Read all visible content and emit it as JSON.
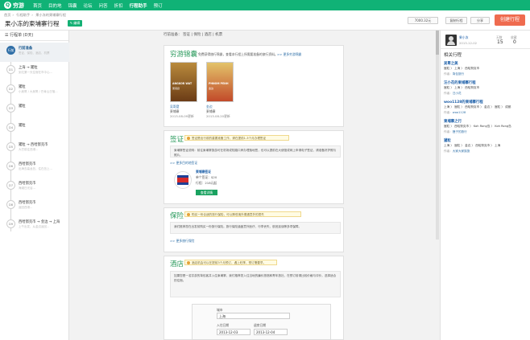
{
  "nav": {
    "logo": "穷游",
    "items": [
      "首页",
      "目的地",
      "锦囊",
      "论坛",
      "问答",
      "折扣",
      "行程助手",
      "预订"
    ],
    "active_index": 6
  },
  "breadcrumb": [
    "首页",
    "行程助手",
    "果小冻的柬埔寨行程"
  ],
  "page": {
    "title": "果小冻的柬埔寨行程",
    "badge": "✎ 编辑"
  },
  "header_buttons": {
    "cost": "7000.32元",
    "copy": "复制行程",
    "share": "分享",
    "create": "创建行程"
  },
  "left": {
    "header": "行程单 (D天)",
    "items": [
      {
        "circle": "行前",
        "title": "行前准备",
        "sub": "签证、保险、酒店、机票",
        "selected": true
      },
      {
        "circle": "D1",
        "title": "上海 → 暹粒",
        "sub": "到达第一天住宿在市中心..."
      },
      {
        "circle": "D2",
        "title": "暹粒",
        "sub": "小吴哥 / 大吴哥 / 巴肯山日落..."
      },
      {
        "circle": "D3",
        "title": "暹粒",
        "sub": ""
      },
      {
        "circle": "D4",
        "title": "暹粒",
        "sub": ""
      },
      {
        "circle": "D5",
        "title": "暹粒 → 西哈努克市",
        "sub": "大巴前往西港..."
      },
      {
        "circle": "D6",
        "title": "西哈努克市",
        "sub": "出海去高龙岛，住在岛上..."
      },
      {
        "circle": "D7",
        "title": "西哈努克市",
        "sub": "海滩日光浴..."
      },
      {
        "circle": "D8",
        "title": "西哈努克市",
        "sub": "返回西港..."
      },
      {
        "circle": "D9",
        "title": "西哈努克市 → 金边 → 上海",
        "sub": "上午出发，从金边返回..."
      }
    ]
  },
  "tabs": {
    "label": "行前准备：",
    "items": [
      "签证",
      "保险",
      "酒店",
      "机票"
    ]
  },
  "guide": {
    "title": "穷游锦囊",
    "intro": "免费获得旅行锦囊，查看本行程上所需要准备的旅行资料。",
    "more": ">> 更多穷游锦囊",
    "books": [
      {
        "cover_title": "ANGKOR WAT",
        "cover_sub": "吴哥窟",
        "tag": "吴哥窟",
        "place": "柬埔寨",
        "date": "2013-08-09更新"
      },
      {
        "cover_title": "PHNOM PENH",
        "cover_sub": "金边",
        "tag": "金边",
        "place": "柬埔寨",
        "date": "2013-08-20更新"
      }
    ]
  },
  "visa": {
    "title": "签证",
    "note": "签证是出行前的重要准备工作，请在提前1-3个月办理签证",
    "gray": "柬埔寨签证说明：前往柬埔寨旅游可在机场或陆路口岸办理落地签，也可以提前在大使馆或网上申请电子签证，请准备好护照与照片。",
    "more": ">> 更多目的地签证",
    "card_title": "柬埔寨签证",
    "card_price": "单个签证：$20",
    "card_count": "行程：218元起",
    "card_btn": "查看详情"
  },
  "insurance": {
    "title": "保险",
    "note": "购买一份合适的旅行保险，可以降低境外遭遇意外的损失",
    "gray": "我们推荐您在出发前购买一份旅行保险。旅行保险涵盖意外医疗、行李丢失、航班延误等多项保障。",
    "more": ">> 更多旅行保险"
  },
  "hotel": {
    "title": "酒店",
    "note": "酒店机会可以在提前3个月预订，遇上旺季，预订需要早。",
    "gray": "如果您是一名穷游的背包客并入住柬埔寨，我们推荐您入住当地的廉价旅馆和青年旅社，在预订前请比较价格与评价，选择适合的住宿。",
    "form": {
      "city_label": "城市",
      "city": "上海",
      "checkin_label": "入住日期",
      "checkin": "2013-12-03",
      "checkout_label": "退房日期",
      "checkout": "2013-12-04"
    }
  },
  "right": {
    "user": {
      "name": "果小冻",
      "date": "2013-12-02",
      "days_label": "天数",
      "days": "15",
      "likes_label": "收藏",
      "likes": "0"
    },
    "related_title": "相关行程",
    "trips": [
      {
        "title": "吴哥之美",
        "route": "暹粒 〉 上海 〉 西哈努克市",
        "author_label": "作者：",
        "author": "背包旅行"
      },
      {
        "title": "汪小花的柬埔寨行程",
        "route": "暹粒 〉 上海 〉 西哈努克市",
        "author_label": "作者：",
        "author": "汪小花"
      },
      {
        "title": "woo1128的柬埔寨行程",
        "route": "上海 〉 暹粒 〉 西哈努克市 〉 金边 〉 暹粒 〉 成都",
        "author_label": "作者：",
        "author": "woo1128"
      },
      {
        "title": "柬埔寨之行",
        "route": "暹粒 〉 西哈努克市 〉 Koh Rong岛 〉 Koh Rong岛",
        "author_label": "作者：",
        "author": "狸子的旅行"
      },
      {
        "title": "暹粒",
        "route": "上海 〉 暹粒 〉 金边 〉 西哈努克市 〉 上海",
        "author_label": "作者：",
        "author": "大家大家族旅"
      }
    ]
  },
  "colors": {
    "brand": "#10b276",
    "accent": "#ef6b4f",
    "link": "#1b5ea8"
  }
}
